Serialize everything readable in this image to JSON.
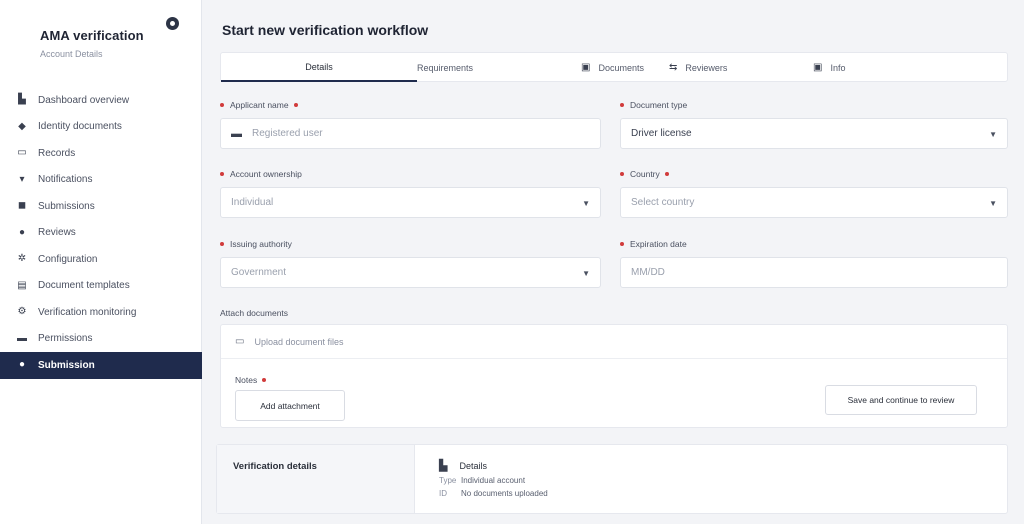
{
  "sidebar": {
    "brand_title": "AMA verification",
    "brand_subtitle": "Account Details",
    "items": [
      {
        "label": "Dashboard overview",
        "icon": "dashboard-icon",
        "glyph": "▙"
      },
      {
        "label": "Identity documents",
        "icon": "identity-icon",
        "glyph": "◆"
      },
      {
        "label": "Records",
        "icon": "records-icon",
        "glyph": "▭"
      },
      {
        "label": "Notifications",
        "icon": "bell-icon",
        "glyph": "▾"
      },
      {
        "label": "Submissions",
        "icon": "stack-icon",
        "glyph": "◼"
      },
      {
        "label": "Reviews",
        "icon": "review-icon",
        "glyph": "●"
      },
      {
        "label": "Configuration",
        "icon": "gear-icon",
        "glyph": "✲"
      },
      {
        "label": "Document templates",
        "icon": "template-icon",
        "glyph": "▤"
      },
      {
        "label": "Verification monitoring",
        "icon": "monitor-icon",
        "glyph": "⚙"
      },
      {
        "label": "Permissions",
        "icon": "permissions-icon",
        "glyph": "▬"
      },
      {
        "label": "Submission",
        "icon": "submission-icon",
        "glyph": "●",
        "active": true
      }
    ]
  },
  "header": {
    "title": "Start new verification workflow"
  },
  "tabs": [
    {
      "label": "Details",
      "active": true
    },
    {
      "label": "Requirements"
    },
    {
      "label": "Documents",
      "icon": "calendar-icon",
      "glyph": "▣"
    },
    {
      "label": "Reviewers",
      "icon": "arrow-icon",
      "glyph": "⇆"
    },
    {
      "label": "Info",
      "icon": "info-icon",
      "glyph": "▣"
    }
  ],
  "form": {
    "applicant_name": {
      "label": "Applicant name",
      "value": "Registered user"
    },
    "document_type": {
      "label": "Document type",
      "value": "Driver license"
    },
    "account_ownership": {
      "label": "Account ownership",
      "value": "Individual"
    },
    "country": {
      "label": "Country",
      "value": "Select country"
    },
    "issuing_authority": {
      "label": "Issuing authority",
      "value": "Government"
    },
    "expiration_date": {
      "label": "Expiration date",
      "value": "MM/DD"
    }
  },
  "attachments": {
    "label": "Attach documents",
    "row_text": "Upload document files",
    "notes_label": "Notes",
    "add_button": "Add attachment",
    "submit_button": "Save and continue to review"
  },
  "summary": {
    "title": "Verification details",
    "heading": "Details",
    "lines": [
      {
        "k": "Type",
        "v": "Individual account"
      },
      {
        "k": "ID",
        "v": "No documents uploaded"
      }
    ]
  }
}
